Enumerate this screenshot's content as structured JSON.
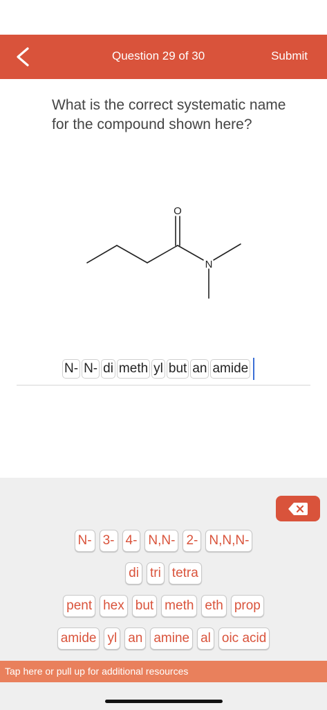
{
  "header": {
    "title": "Question 29 of 30",
    "submit_label": "Submit"
  },
  "question": {
    "text": "What is the correct systematic name for the compound shown here?"
  },
  "structure": {
    "oxygen_label": "O",
    "nitrogen_label": "N"
  },
  "answer": {
    "tokens": [
      "N-",
      "N-",
      "di",
      "meth",
      "yl",
      "but",
      "an",
      "amide"
    ]
  },
  "keyboard": {
    "row1": [
      "N-",
      "3-",
      "4-",
      "N,N-",
      "2-",
      "N,N,N-"
    ],
    "row2": [
      "di",
      "tri",
      "tetra"
    ],
    "row3": [
      "pent",
      "hex",
      "but",
      "meth",
      "eth",
      "prop"
    ],
    "row4": [
      "amide",
      "yl",
      "an",
      "amine",
      "al",
      "oic acid"
    ],
    "resources_label": "Tap here or pull up for additional resources"
  },
  "colors": {
    "accent": "#d9533b",
    "resources_bar": "#e9805c",
    "keyboard_bg": "#efefef"
  }
}
